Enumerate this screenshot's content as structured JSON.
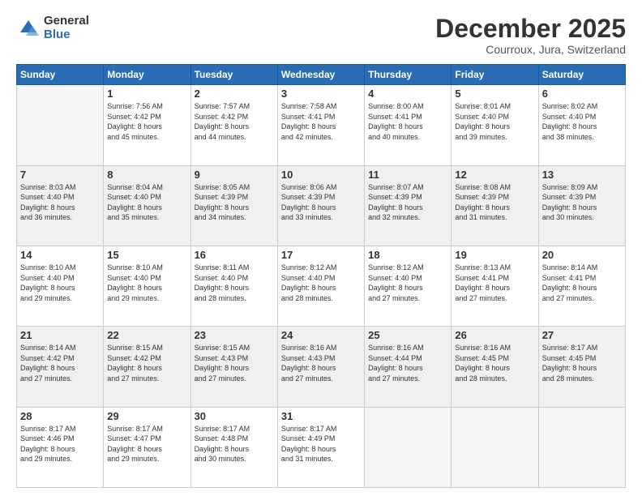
{
  "logo": {
    "general": "General",
    "blue": "Blue"
  },
  "header": {
    "month": "December 2025",
    "location": "Courroux, Jura, Switzerland"
  },
  "days_of_week": [
    "Sunday",
    "Monday",
    "Tuesday",
    "Wednesday",
    "Thursday",
    "Friday",
    "Saturday"
  ],
  "weeks": [
    [
      {
        "day": "",
        "info": ""
      },
      {
        "day": "1",
        "info": "Sunrise: 7:56 AM\nSunset: 4:42 PM\nDaylight: 8 hours\nand 45 minutes."
      },
      {
        "day": "2",
        "info": "Sunrise: 7:57 AM\nSunset: 4:42 PM\nDaylight: 8 hours\nand 44 minutes."
      },
      {
        "day": "3",
        "info": "Sunrise: 7:58 AM\nSunset: 4:41 PM\nDaylight: 8 hours\nand 42 minutes."
      },
      {
        "day": "4",
        "info": "Sunrise: 8:00 AM\nSunset: 4:41 PM\nDaylight: 8 hours\nand 40 minutes."
      },
      {
        "day": "5",
        "info": "Sunrise: 8:01 AM\nSunset: 4:40 PM\nDaylight: 8 hours\nand 39 minutes."
      },
      {
        "day": "6",
        "info": "Sunrise: 8:02 AM\nSunset: 4:40 PM\nDaylight: 8 hours\nand 38 minutes."
      }
    ],
    [
      {
        "day": "7",
        "info": "Sunrise: 8:03 AM\nSunset: 4:40 PM\nDaylight: 8 hours\nand 36 minutes."
      },
      {
        "day": "8",
        "info": "Sunrise: 8:04 AM\nSunset: 4:40 PM\nDaylight: 8 hours\nand 35 minutes."
      },
      {
        "day": "9",
        "info": "Sunrise: 8:05 AM\nSunset: 4:39 PM\nDaylight: 8 hours\nand 34 minutes."
      },
      {
        "day": "10",
        "info": "Sunrise: 8:06 AM\nSunset: 4:39 PM\nDaylight: 8 hours\nand 33 minutes."
      },
      {
        "day": "11",
        "info": "Sunrise: 8:07 AM\nSunset: 4:39 PM\nDaylight: 8 hours\nand 32 minutes."
      },
      {
        "day": "12",
        "info": "Sunrise: 8:08 AM\nSunset: 4:39 PM\nDaylight: 8 hours\nand 31 minutes."
      },
      {
        "day": "13",
        "info": "Sunrise: 8:09 AM\nSunset: 4:39 PM\nDaylight: 8 hours\nand 30 minutes."
      }
    ],
    [
      {
        "day": "14",
        "info": "Sunrise: 8:10 AM\nSunset: 4:40 PM\nDaylight: 8 hours\nand 29 minutes."
      },
      {
        "day": "15",
        "info": "Sunrise: 8:10 AM\nSunset: 4:40 PM\nDaylight: 8 hours\nand 29 minutes."
      },
      {
        "day": "16",
        "info": "Sunrise: 8:11 AM\nSunset: 4:40 PM\nDaylight: 8 hours\nand 28 minutes."
      },
      {
        "day": "17",
        "info": "Sunrise: 8:12 AM\nSunset: 4:40 PM\nDaylight: 8 hours\nand 28 minutes."
      },
      {
        "day": "18",
        "info": "Sunrise: 8:12 AM\nSunset: 4:40 PM\nDaylight: 8 hours\nand 27 minutes."
      },
      {
        "day": "19",
        "info": "Sunrise: 8:13 AM\nSunset: 4:41 PM\nDaylight: 8 hours\nand 27 minutes."
      },
      {
        "day": "20",
        "info": "Sunrise: 8:14 AM\nSunset: 4:41 PM\nDaylight: 8 hours\nand 27 minutes."
      }
    ],
    [
      {
        "day": "21",
        "info": "Sunrise: 8:14 AM\nSunset: 4:42 PM\nDaylight: 8 hours\nand 27 minutes."
      },
      {
        "day": "22",
        "info": "Sunrise: 8:15 AM\nSunset: 4:42 PM\nDaylight: 8 hours\nand 27 minutes."
      },
      {
        "day": "23",
        "info": "Sunrise: 8:15 AM\nSunset: 4:43 PM\nDaylight: 8 hours\nand 27 minutes."
      },
      {
        "day": "24",
        "info": "Sunrise: 8:16 AM\nSunset: 4:43 PM\nDaylight: 8 hours\nand 27 minutes."
      },
      {
        "day": "25",
        "info": "Sunrise: 8:16 AM\nSunset: 4:44 PM\nDaylight: 8 hours\nand 27 minutes."
      },
      {
        "day": "26",
        "info": "Sunrise: 8:16 AM\nSunset: 4:45 PM\nDaylight: 8 hours\nand 28 minutes."
      },
      {
        "day": "27",
        "info": "Sunrise: 8:17 AM\nSunset: 4:45 PM\nDaylight: 8 hours\nand 28 minutes."
      }
    ],
    [
      {
        "day": "28",
        "info": "Sunrise: 8:17 AM\nSunset: 4:46 PM\nDaylight: 8 hours\nand 29 minutes."
      },
      {
        "day": "29",
        "info": "Sunrise: 8:17 AM\nSunset: 4:47 PM\nDaylight: 8 hours\nand 29 minutes."
      },
      {
        "day": "30",
        "info": "Sunrise: 8:17 AM\nSunset: 4:48 PM\nDaylight: 8 hours\nand 30 minutes."
      },
      {
        "day": "31",
        "info": "Sunrise: 8:17 AM\nSunset: 4:49 PM\nDaylight: 8 hours\nand 31 minutes."
      },
      {
        "day": "",
        "info": ""
      },
      {
        "day": "",
        "info": ""
      },
      {
        "day": "",
        "info": ""
      }
    ]
  ]
}
